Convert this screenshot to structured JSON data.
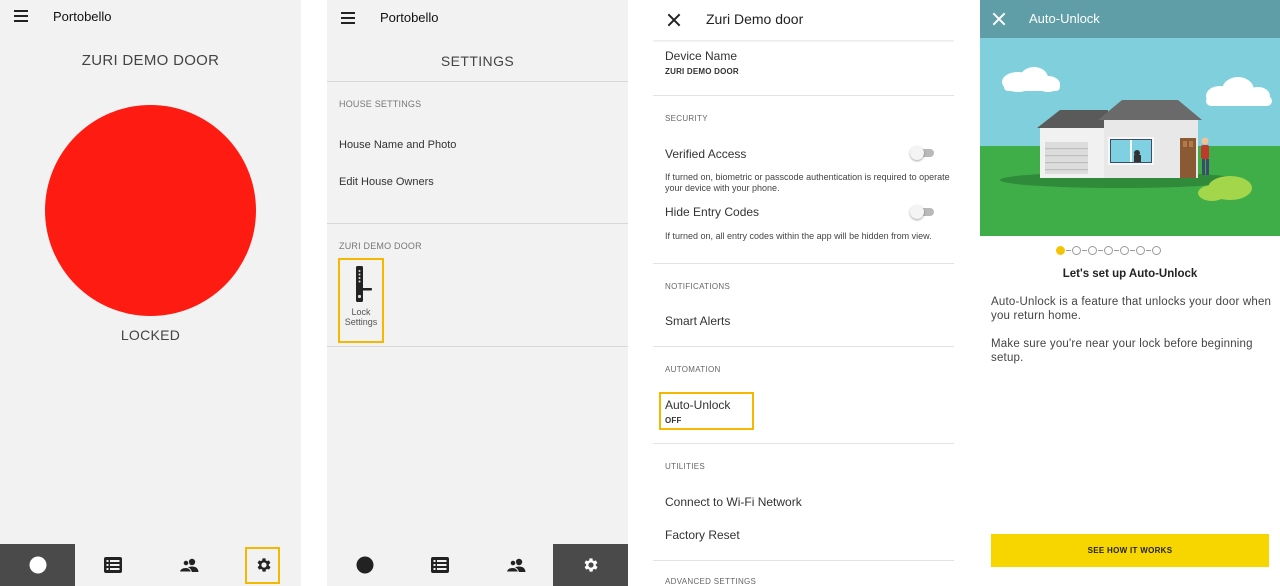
{
  "colors": {
    "locked_red": "#fe1b12",
    "highlight": "#f5b800",
    "nav_active_dark": "#4a4a4a",
    "auto_unlock_header": "#5f9ea6",
    "cta_yellow": "#f7d600",
    "step_active": "#f5c400"
  },
  "screen1": {
    "app_title": "Portobello",
    "door_title": "ZURI DEMO DOOR",
    "lock_status": "LOCKED",
    "nav": [
      {
        "icon": "lock-status-icon",
        "active": true
      },
      {
        "icon": "activity-list-icon",
        "active": false
      },
      {
        "icon": "users-icon",
        "active": false
      },
      {
        "icon": "gear-icon",
        "active": false,
        "highlighted": true
      }
    ]
  },
  "screen2": {
    "app_title": "Portobello",
    "title": "SETTINGS",
    "house_section": "HOUSE SETTINGS",
    "house_items": [
      "House Name and Photo",
      "Edit House Owners"
    ],
    "door_section": "ZURI DEMO DOOR",
    "lock_settings_line1": "Lock",
    "lock_settings_line2": "Settings",
    "nav": [
      {
        "icon": "lock-status-icon",
        "active": false
      },
      {
        "icon": "activity-list-icon",
        "active": false
      },
      {
        "icon": "users-icon",
        "active": false
      },
      {
        "icon": "gear-icon",
        "active": true
      }
    ]
  },
  "screen3": {
    "title": "Zuri Demo door",
    "device_name_label": "Device Name",
    "device_name_value": "ZURI DEMO DOOR",
    "security_section": "SECURITY",
    "verified_access_label": "Verified Access",
    "verified_access_desc": "If turned on, biometric or passcode authentication is required to operate your device with your phone.",
    "hide_codes_label": "Hide Entry Codes",
    "hide_codes_desc": "If turned on, all entry codes within the app will be hidden from view.",
    "notifications_section": "NOTIFICATIONS",
    "smart_alerts_label": "Smart Alerts",
    "automation_section": "AUTOMATION",
    "auto_unlock_label": "Auto-Unlock",
    "auto_unlock_value": "OFF",
    "utilities_section": "UTILITIES",
    "wifi_label": "Connect to Wi-Fi Network",
    "factory_reset_label": "Factory Reset",
    "advanced_section": "ADVANCED SETTINGS"
  },
  "screen4": {
    "title": "Auto-Unlock",
    "steps_total": 7,
    "current_step": 1,
    "heading": "Let's set up Auto-Unlock",
    "para1": "Auto-Unlock is a feature that unlocks your door when you return home.",
    "para2": "Make sure you're near your lock before beginning setup.",
    "cta_label": "SEE HOW IT WORKS"
  }
}
